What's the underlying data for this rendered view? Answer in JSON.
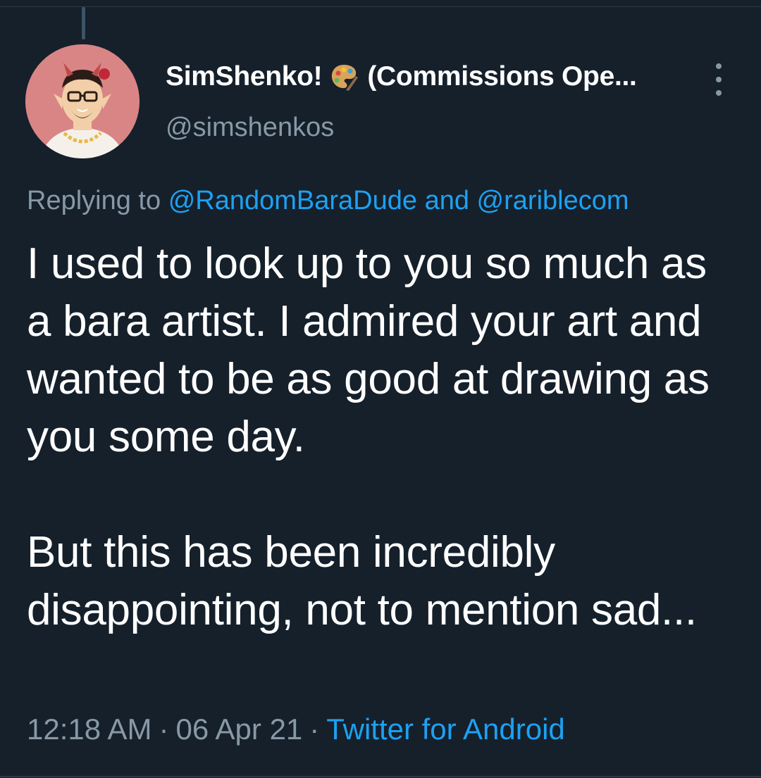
{
  "tweet": {
    "author": {
      "display_name_part1": "SimShenko!",
      "display_name_part2": "(Commissions Ope...",
      "handle": "@simshenkos",
      "avatar_icon": "cartoon-avatar-icon",
      "name_emoji": "artist-palette-icon"
    },
    "replying": {
      "prefix": "Replying to",
      "mention1": "@RandomBaraDude",
      "joiner": "and",
      "mention2": "@rariblecom"
    },
    "body": {
      "paragraph1": "I used to look up to you so much as a bara artist. I admired your art and wanted to be as good at drawing as you some day.",
      "paragraph2": "But this has been incredibly disappointing, not to mention sad..."
    },
    "meta": {
      "time": "12:18 AM",
      "separator": "·",
      "date": "06 Apr 21",
      "source": "Twitter for Android"
    }
  },
  "colors": {
    "background": "#15202b",
    "text_primary": "#ffffff",
    "text_secondary": "#8899a6",
    "link": "#1da1f2",
    "avatar_bg": "#d98585"
  },
  "icons": {
    "more": "more-vertical-icon"
  }
}
